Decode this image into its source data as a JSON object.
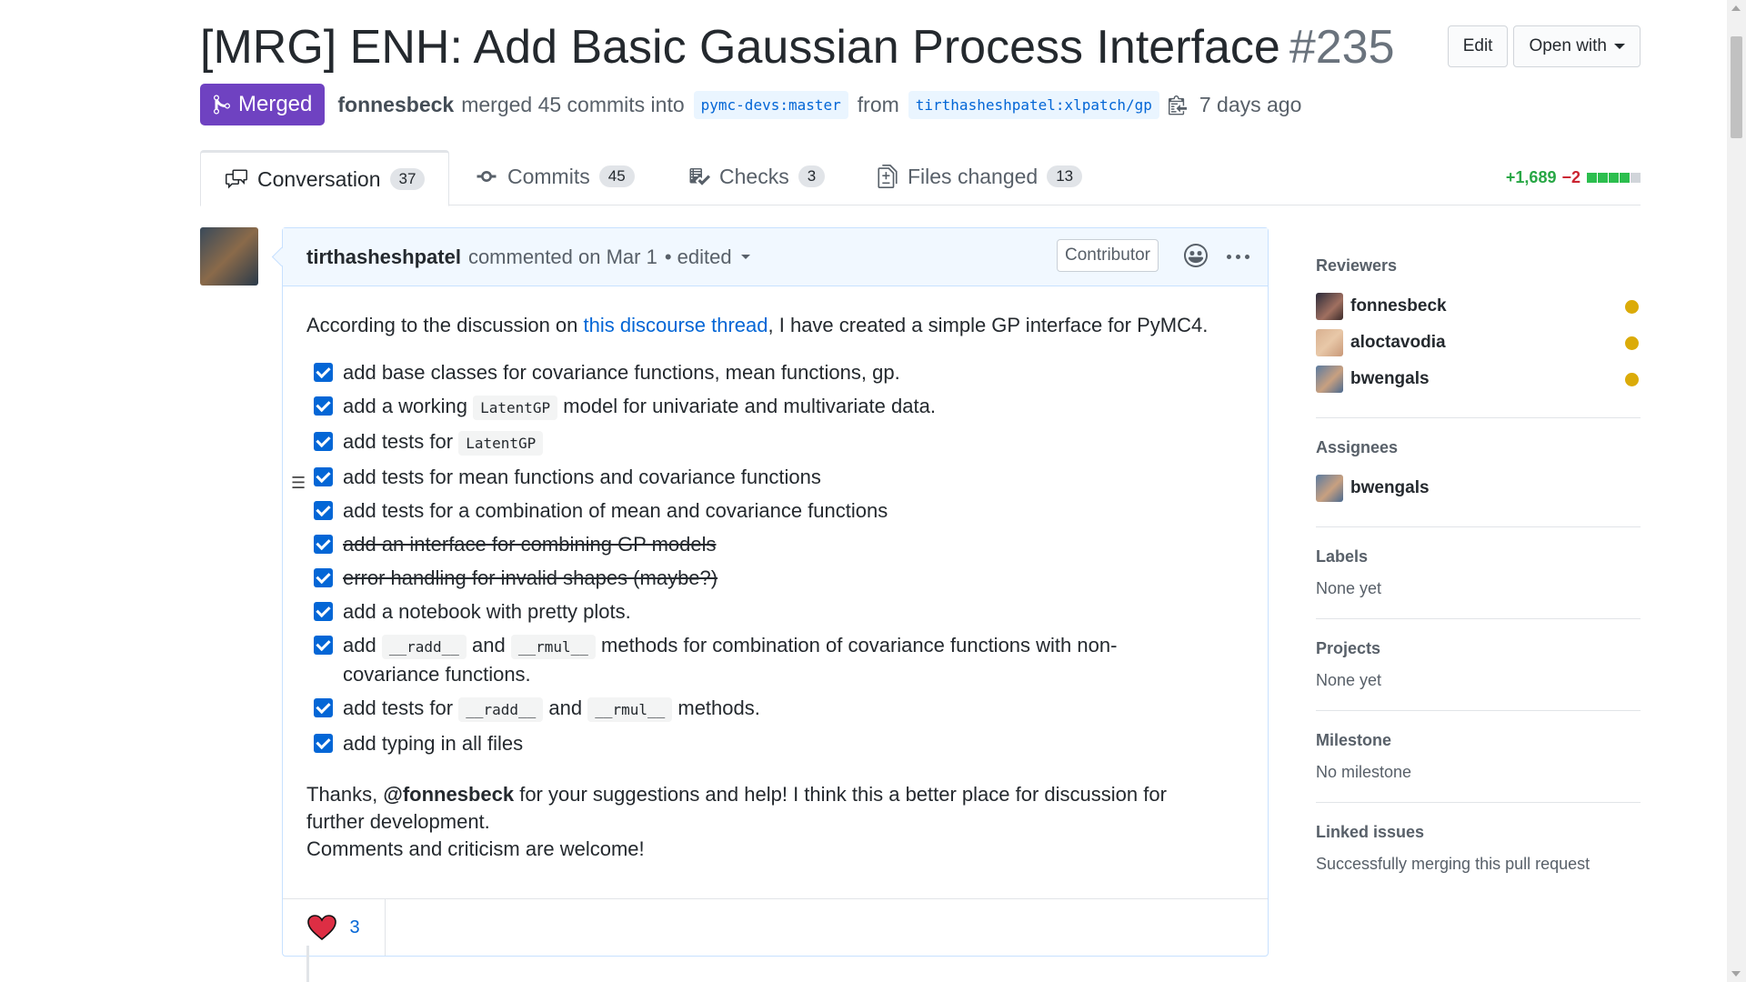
{
  "pr": {
    "title": "[MRG] ENH: Add Basic Gaussian Process Interface",
    "number": "#235",
    "state": "Merged",
    "merged_by": "fonnesbeck",
    "merge_text": "merged 45 commits into",
    "base_ref": "pymc-devs:master",
    "from_text": "from",
    "head_ref": "tirthasheshpatel:xlpatch/gp",
    "ago": "7 days ago"
  },
  "header_buttons": {
    "edit": "Edit",
    "open_with": "Open with"
  },
  "tabs": [
    {
      "label": "Conversation",
      "count": "37"
    },
    {
      "label": "Commits",
      "count": "45"
    },
    {
      "label": "Checks",
      "count": "3"
    },
    {
      "label": "Files changed",
      "count": "13"
    }
  ],
  "diffstat": {
    "additions": "+1,689",
    "deletions": "−2"
  },
  "comment": {
    "author": "tirthasheshpatel",
    "when": "commented on Mar 1",
    "edited": "• edited",
    "role": "Contributor",
    "intro_before": "According to the discussion on ",
    "intro_link": "this discourse thread",
    "intro_after": ", I have created a simple GP interface for PyMC4.",
    "tasks": {
      "t1": "add base classes for covariance functions, mean functions, gp.",
      "t2a": "add a working ",
      "t2code": "LatentGP",
      "t2b": " model for univariate and multivariate data.",
      "t3a": "add tests for ",
      "t3code": "LatentGP",
      "t4": "add tests for mean functions and covariance functions",
      "t5": "add tests for a combination of mean and covariance functions",
      "t6": "add an interface for combining GP models",
      "t7": "error handling for invalid shapes (maybe?)",
      "t8": "add a notebook with pretty plots.",
      "t9a": "add ",
      "t9code1": "__radd__",
      "t9b": " and ",
      "t9code2": "__rmul__",
      "t9c": " methods for combination of covariance functions with non-covariance functions.",
      "t10a": "add tests for ",
      "t10code1": "__radd__",
      "t10b": " and ",
      "t10code2": "__rmul__",
      "t10c": " methods.",
      "t11": "add typing in all files"
    },
    "thanks_before": "Thanks, ",
    "thanks_mention": "@fonnesbeck",
    "thanks_after": " for your suggestions and help! I think this a better place for discussion for further development.",
    "closing": "Comments and criticism are welcome!",
    "reaction_count": "3"
  },
  "sidebar": {
    "reviewers_title": "Reviewers",
    "reviewers": [
      "fonnesbeck",
      "aloctavodia",
      "bwengals"
    ],
    "assignees_title": "Assignees",
    "assignees": [
      "bwengals"
    ],
    "labels_title": "Labels",
    "labels_value": "None yet",
    "projects_title": "Projects",
    "projects_value": "None yet",
    "milestone_title": "Milestone",
    "milestone_value": "No milestone",
    "linked_title": "Linked issues",
    "linked_value": "Successfully merging this pull request"
  },
  "colors": {
    "merged": "#6f42c1",
    "link": "#0366d6",
    "pending_dot": "#dbab09",
    "add": "#28a745",
    "del": "#cb2431"
  }
}
